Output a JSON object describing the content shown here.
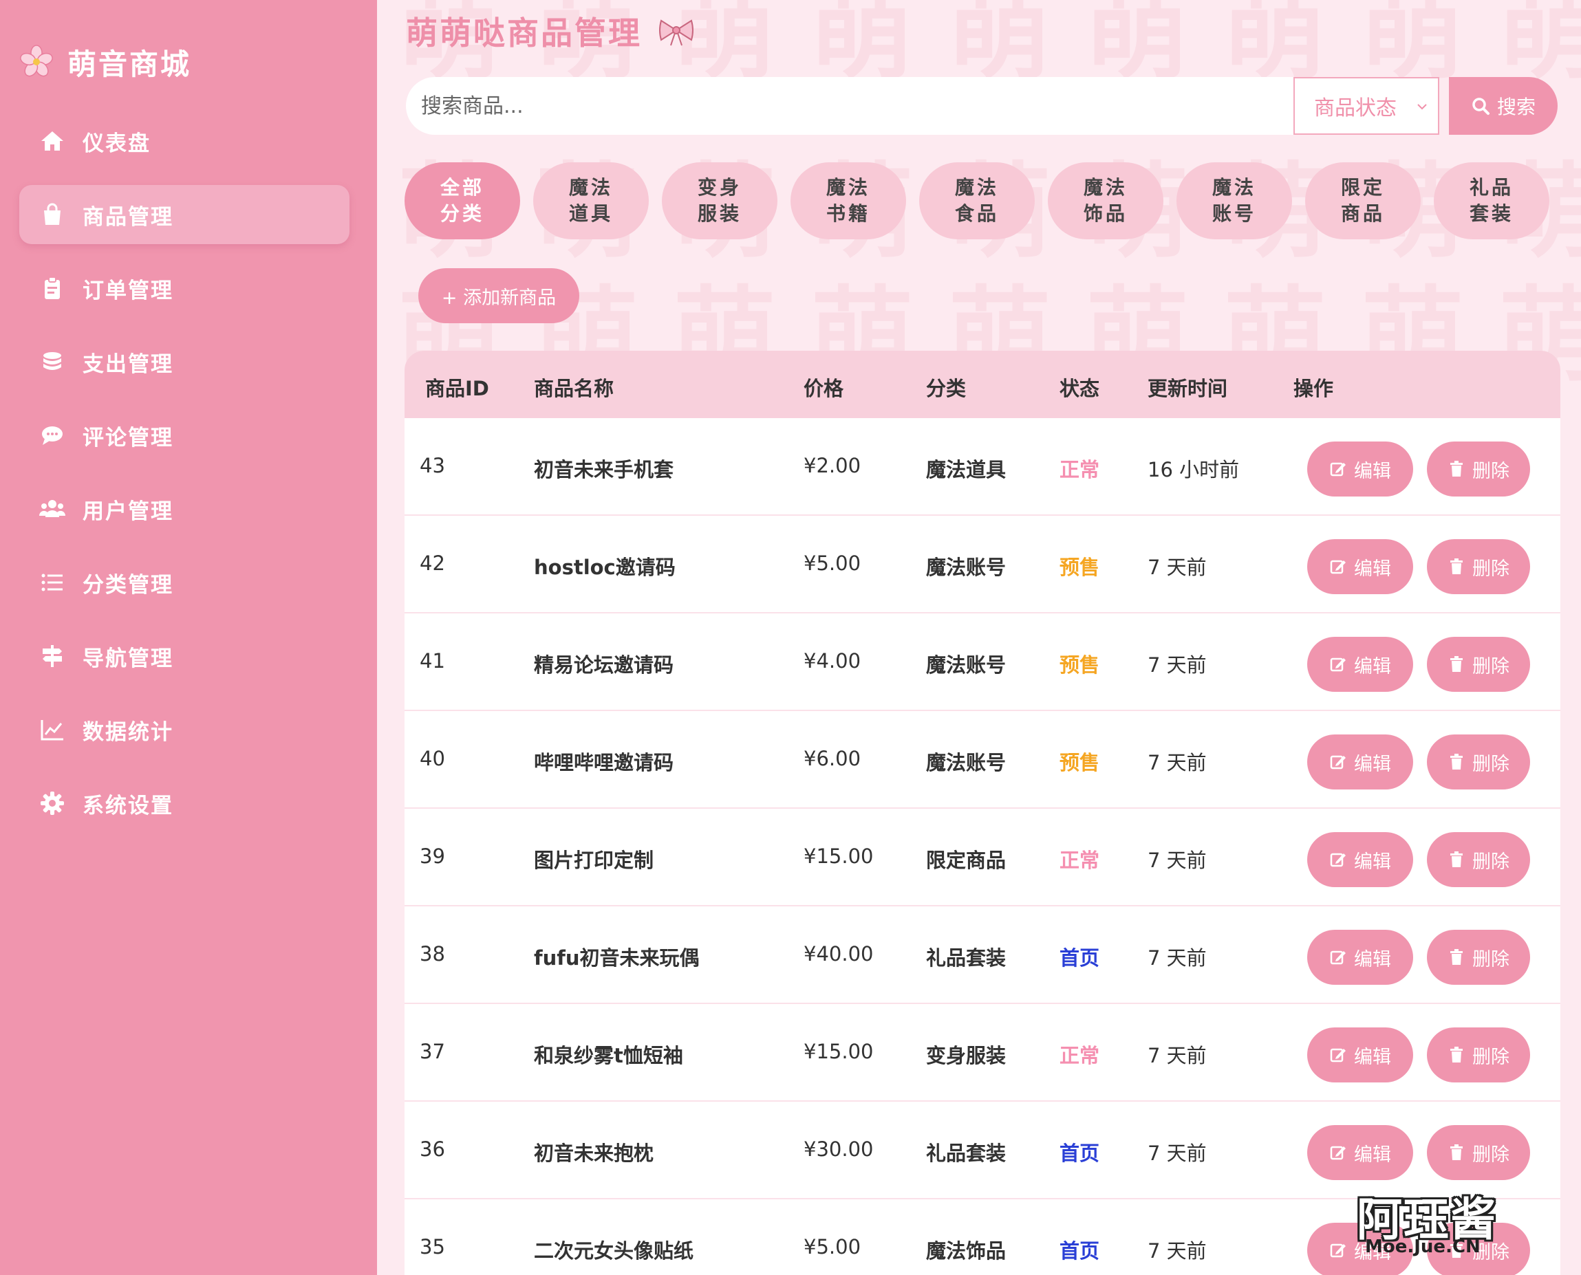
{
  "brand": {
    "name": "萌音商城"
  },
  "sidebar": {
    "items": [
      {
        "label": "仪表盘",
        "icon": "home-icon"
      },
      {
        "label": "商品管理",
        "icon": "shopping-bag-icon",
        "active": true
      },
      {
        "label": "订单管理",
        "icon": "clipboard-icon"
      },
      {
        "label": "支出管理",
        "icon": "coins-icon"
      },
      {
        "label": "评论管理",
        "icon": "comment-icon"
      },
      {
        "label": "用户管理",
        "icon": "users-icon"
      },
      {
        "label": "分类管理",
        "icon": "list-icon"
      },
      {
        "label": "导航管理",
        "icon": "signpost-icon"
      },
      {
        "label": "数据统计",
        "icon": "chart-line-icon"
      },
      {
        "label": "系统设置",
        "icon": "gear-icon"
      }
    ]
  },
  "main": {
    "title": "萌萌哒商品管理",
    "search": {
      "placeholder": "搜索商品...",
      "status_label": "商品状态",
      "button_label": "搜索"
    },
    "categories": [
      {
        "label": "全部\n分类",
        "active": true
      },
      {
        "label": "魔法\n道具"
      },
      {
        "label": "变身\n服装"
      },
      {
        "label": "魔法\n书籍"
      },
      {
        "label": "魔法\n食品"
      },
      {
        "label": "魔法\n饰品"
      },
      {
        "label": "魔法\n账号"
      },
      {
        "label": "限定\n商品"
      },
      {
        "label": "礼品\n套装"
      }
    ],
    "add_button": "+ 添加新商品",
    "table": {
      "columns": [
        "商品ID",
        "商品名称",
        "价格",
        "分类",
        "状态",
        "更新时间",
        "操作"
      ],
      "edit_label": "编辑",
      "delete_label": "删除",
      "rows": [
        {
          "id": "43",
          "name": "初音未来手机套",
          "price": "¥2.00",
          "category": "魔法道具",
          "status": "正常",
          "updated": "16 小时前"
        },
        {
          "id": "42",
          "name": "hostloc邀请码",
          "price": "¥5.00",
          "category": "魔法账号",
          "status": "预售",
          "updated": "7 天前"
        },
        {
          "id": "41",
          "name": "精易论坛邀请码",
          "price": "¥4.00",
          "category": "魔法账号",
          "status": "预售",
          "updated": "7 天前"
        },
        {
          "id": "40",
          "name": "哔哩哔哩邀请码",
          "price": "¥6.00",
          "category": "魔法账号",
          "status": "预售",
          "updated": "7 天前"
        },
        {
          "id": "39",
          "name": "图片打印定制",
          "price": "¥15.00",
          "category": "限定商品",
          "status": "正常",
          "updated": "7 天前"
        },
        {
          "id": "38",
          "name": "fufu初音未来玩偶",
          "price": "¥40.00",
          "category": "礼品套装",
          "status": "首页",
          "updated": "7 天前"
        },
        {
          "id": "37",
          "name": "和泉纱雾t恤短袖",
          "price": "¥15.00",
          "category": "变身服装",
          "status": "正常",
          "updated": "7 天前"
        },
        {
          "id": "36",
          "name": "初音未来抱枕",
          "price": "¥30.00",
          "category": "礼品套装",
          "status": "首页",
          "updated": "7 天前"
        },
        {
          "id": "35",
          "name": "二次元女头像贴纸",
          "price": "¥5.00",
          "category": "魔法饰品",
          "status": "首页",
          "updated": "7 天前"
        }
      ]
    },
    "watermark_char": "萌"
  },
  "colors": {
    "primary": "#f095ae",
    "status_normal": "#f58fb0",
    "status_presale": "#f5a623",
    "status_home": "#2a3fd6"
  },
  "credit": {
    "main": "阿珏酱",
    "sub": "Moe.Jue.CN"
  }
}
